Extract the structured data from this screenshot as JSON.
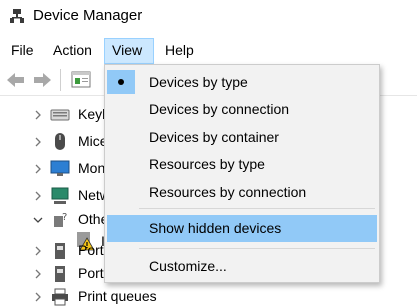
{
  "window": {
    "title": "Device Manager",
    "icon": "device-manager-icon"
  },
  "menubar": {
    "items": [
      {
        "label": "File"
      },
      {
        "label": "Action"
      },
      {
        "label": "View",
        "active": true
      },
      {
        "label": "Help"
      }
    ]
  },
  "toolbar": {
    "buttons": [
      "back-arrow-icon",
      "forward-arrow-icon",
      "properties-icon"
    ]
  },
  "tree": {
    "rows": [
      {
        "label": "Keyb",
        "icon": "keyboard-icon",
        "expanded": false
      },
      {
        "label": "Mice",
        "icon": "mouse-icon",
        "expanded": false
      },
      {
        "label": "Mon",
        "icon": "monitor-icon",
        "expanded": false
      },
      {
        "label": "Netw",
        "icon": "network-adapter-icon",
        "expanded": false
      },
      {
        "label": "Othe",
        "icon": "other-devices-icon",
        "expanded": true
      },
      {
        "label": "I",
        "icon": "warning-device-icon",
        "child": true
      },
      {
        "label": "Port",
        "icon": "port-icon",
        "expanded": false
      },
      {
        "label": "Port",
        "icon": "port-icon",
        "expanded": false
      },
      {
        "label": "Print queues",
        "icon": "printer-icon",
        "expanded": false
      }
    ]
  },
  "view_menu": {
    "items": [
      {
        "label": "Devices by type",
        "checked": true
      },
      {
        "label": "Devices by connection"
      },
      {
        "label": "Devices by container"
      },
      {
        "label": "Resources by type"
      },
      {
        "label": "Resources by connection"
      },
      {
        "label": "Show hidden devices",
        "highlighted": true
      },
      {
        "label": "Customize..."
      }
    ]
  },
  "colors": {
    "menu_active_bg": "#cce8ff",
    "dropdown_bg": "#f2f2f2",
    "dropdown_highlight": "#91c9f7"
  }
}
